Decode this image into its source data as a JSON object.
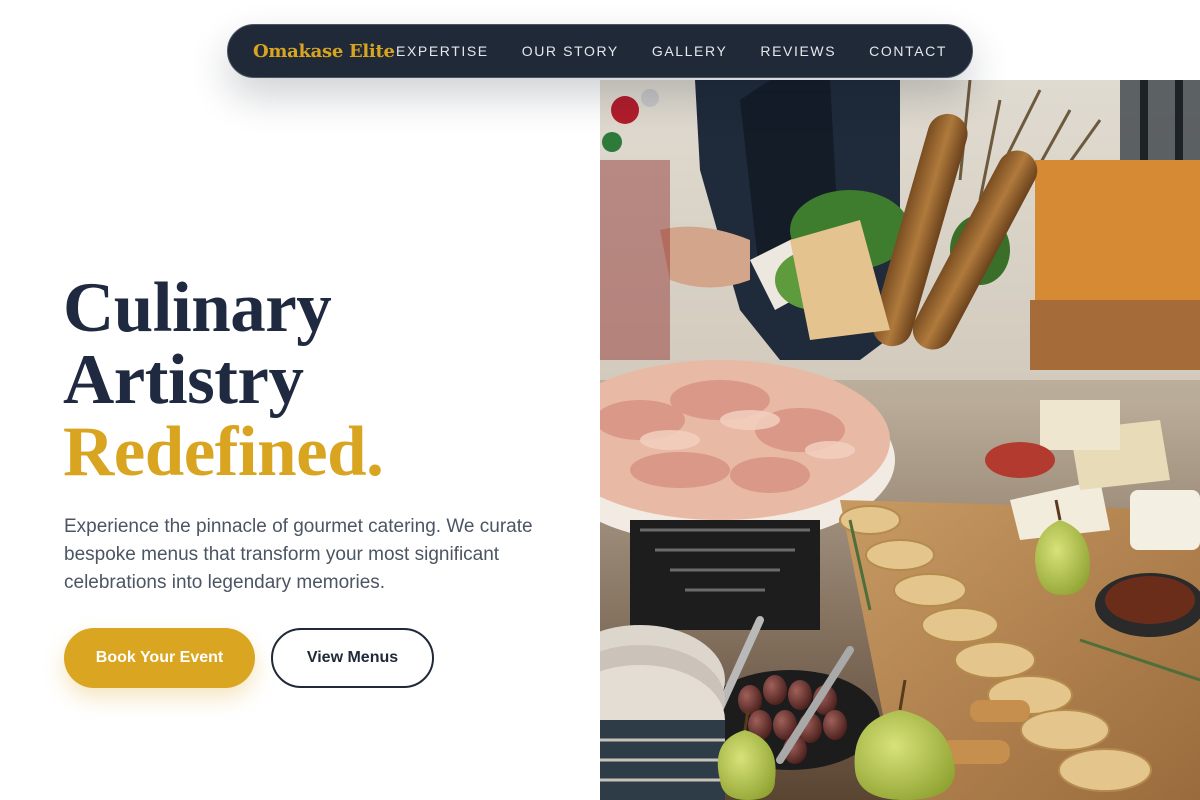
{
  "nav": {
    "brand": "Omakase Elite",
    "links": [
      "EXPERTISE",
      "OUR STORY",
      "GALLERY",
      "REVIEWS",
      "CONTACT"
    ]
  },
  "hero": {
    "title_line1": "Culinary",
    "title_line2": "Artistry",
    "title_line3": "Redefined.",
    "subtitle": "Experience the pinnacle of gourmet catering. We curate bespoke menus that transform your most significant celebrations into legendary memories.",
    "primary_button": "Book Your Event",
    "secondary_button": "View Menus"
  },
  "colors": {
    "accent": "#daa520",
    "navy": "#1f2937",
    "heading": "#1f2a40",
    "body_text": "#4b5563"
  },
  "image": {
    "subject": "catering-buffet-photo"
  }
}
